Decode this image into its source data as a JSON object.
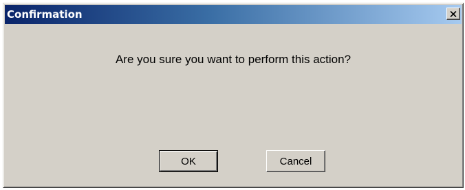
{
  "window": {
    "title": "Confirmation",
    "close_icon": "close-icon"
  },
  "dialog": {
    "message": "Are you sure you want to perform this action?"
  },
  "buttons": {
    "ok_label": "OK",
    "cancel_label": "Cancel"
  },
  "colors": {
    "face": "#d4d0c8",
    "title_start": "#0a246a",
    "title_end": "#a6caf0",
    "title_text": "#ffffff"
  }
}
